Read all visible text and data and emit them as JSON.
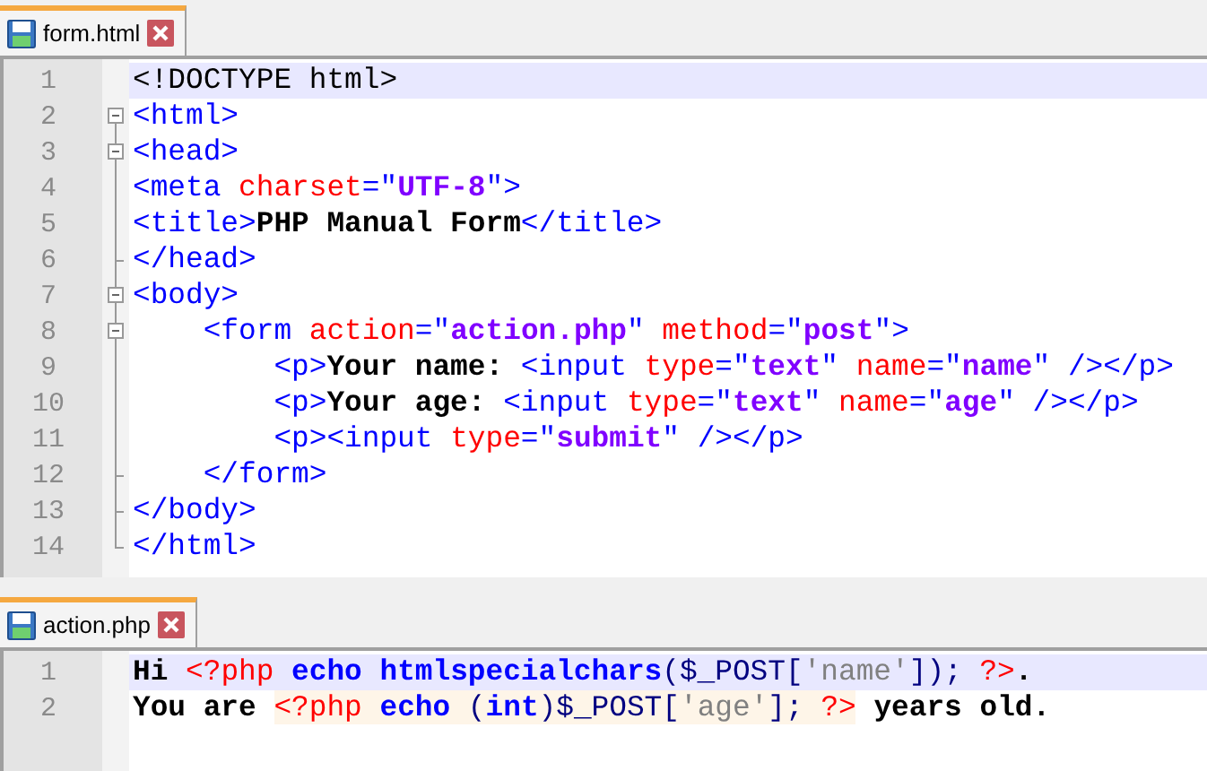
{
  "editors": [
    {
      "tab": {
        "label": "form.html",
        "selected": true
      },
      "lines": [
        {
          "number": "1",
          "current": true,
          "tokens": [
            {
              "kind": "doctype",
              "text": "<!DOCTYPE html>"
            }
          ]
        },
        {
          "number": "2",
          "current": false,
          "fold": {
            "kind": "box"
          },
          "tokens": [
            {
              "kind": "tag",
              "text": "<html>"
            }
          ]
        },
        {
          "number": "3",
          "current": false,
          "fold": {
            "kind": "box"
          },
          "tokens": [
            {
              "kind": "tag",
              "text": "<head>"
            }
          ]
        },
        {
          "number": "4",
          "current": false,
          "fold": {
            "kind": "line"
          },
          "tokens": [
            {
              "kind": "tag",
              "text": "<meta "
            },
            {
              "kind": "attr",
              "text": "charset"
            },
            {
              "kind": "tag",
              "text": "=\""
            },
            {
              "kind": "value",
              "text": "UTF-8"
            },
            {
              "kind": "tag",
              "text": "\">"
            }
          ]
        },
        {
          "number": "5",
          "current": false,
          "fold": {
            "kind": "line"
          },
          "tokens": [
            {
              "kind": "tag",
              "text": "<title>"
            },
            {
              "kind": "text",
              "text": "PHP Manual Form"
            },
            {
              "kind": "tag",
              "text": "</title>"
            }
          ]
        },
        {
          "number": "6",
          "current": false,
          "fold": {
            "kind": "end"
          },
          "tokens": [
            {
              "kind": "tag",
              "text": "</head>"
            }
          ]
        },
        {
          "number": "7",
          "current": false,
          "fold": {
            "kind": "box"
          },
          "tokens": [
            {
              "kind": "tag",
              "text": "<body>"
            }
          ]
        },
        {
          "number": "8",
          "current": false,
          "fold": {
            "kind": "box"
          },
          "tokens": [
            {
              "kind": "tag",
              "text": "    <form "
            },
            {
              "kind": "attr",
              "text": "action"
            },
            {
              "kind": "tag",
              "text": "=\""
            },
            {
              "kind": "value",
              "text": "action.php"
            },
            {
              "kind": "tag",
              "text": "\" "
            },
            {
              "kind": "attr",
              "text": "method"
            },
            {
              "kind": "tag",
              "text": "=\""
            },
            {
              "kind": "value",
              "text": "post"
            },
            {
              "kind": "tag",
              "text": "\">"
            }
          ]
        },
        {
          "number": "9",
          "current": false,
          "fold": {
            "kind": "line"
          },
          "tokens": [
            {
              "kind": "tag",
              "text": "        <p>"
            },
            {
              "kind": "text",
              "text": "Your name: "
            },
            {
              "kind": "tag",
              "text": "<input "
            },
            {
              "kind": "attr",
              "text": "type"
            },
            {
              "kind": "tag",
              "text": "=\""
            },
            {
              "kind": "value",
              "text": "text"
            },
            {
              "kind": "tag",
              "text": "\" "
            },
            {
              "kind": "attr",
              "text": "name"
            },
            {
              "kind": "tag",
              "text": "=\""
            },
            {
              "kind": "value",
              "text": "name"
            },
            {
              "kind": "tag",
              "text": "\" /></p>"
            }
          ]
        },
        {
          "number": "10",
          "current": false,
          "fold": {
            "kind": "line"
          },
          "tokens": [
            {
              "kind": "tag",
              "text": "        <p>"
            },
            {
              "kind": "text",
              "text": "Your age: "
            },
            {
              "kind": "tag",
              "text": "<input "
            },
            {
              "kind": "attr",
              "text": "type"
            },
            {
              "kind": "tag",
              "text": "=\""
            },
            {
              "kind": "value",
              "text": "text"
            },
            {
              "kind": "tag",
              "text": "\" "
            },
            {
              "kind": "attr",
              "text": "name"
            },
            {
              "kind": "tag",
              "text": "=\""
            },
            {
              "kind": "value",
              "text": "age"
            },
            {
              "kind": "tag",
              "text": "\" /></p>"
            }
          ]
        },
        {
          "number": "11",
          "current": false,
          "fold": {
            "kind": "line"
          },
          "tokens": [
            {
              "kind": "tag",
              "text": "        <p><input "
            },
            {
              "kind": "attr",
              "text": "type"
            },
            {
              "kind": "tag",
              "text": "=\""
            },
            {
              "kind": "value",
              "text": "submit"
            },
            {
              "kind": "tag",
              "text": "\" /></p>"
            }
          ]
        },
        {
          "number": "12",
          "current": false,
          "fold": {
            "kind": "end"
          },
          "tokens": [
            {
              "kind": "tag",
              "text": "    </form>"
            }
          ]
        },
        {
          "number": "13",
          "current": false,
          "fold": {
            "kind": "end"
          },
          "tokens": [
            {
              "kind": "tag",
              "text": "</body>"
            }
          ]
        },
        {
          "number": "14",
          "current": false,
          "fold": {
            "kind": "last"
          },
          "tokens": [
            {
              "kind": "tag",
              "text": "</html>"
            }
          ]
        }
      ]
    },
    {
      "tab": {
        "label": "action.php",
        "selected": true
      },
      "lines": [
        {
          "number": "1",
          "current": true,
          "tokens": [
            {
              "kind": "text",
              "text": "Hi "
            },
            {
              "kind": "php-delim",
              "text": "<?php "
            },
            {
              "kind": "keyword",
              "text": "echo "
            },
            {
              "kind": "keyword",
              "text": "htmlspecialchars"
            },
            {
              "kind": "op",
              "text": "($_POST["
            },
            {
              "kind": "string",
              "text": "'name'"
            },
            {
              "kind": "op",
              "text": "]); "
            },
            {
              "kind": "php-delim",
              "text": "?>"
            },
            {
              "kind": "text",
              "text": "."
            }
          ]
        },
        {
          "number": "2",
          "current": false,
          "tokens": [
            {
              "kind": "text",
              "text": "You are "
            },
            {
              "kind": "php-delim",
              "text": "<?php "
            },
            {
              "kind": "keyword",
              "text": "echo "
            },
            {
              "kind": "op",
              "text": "("
            },
            {
              "kind": "keyword",
              "text": "int"
            },
            {
              "kind": "op",
              "text": ")$_POST["
            },
            {
              "kind": "string",
              "text": "'age'"
            },
            {
              "kind": "op",
              "text": "]; "
            },
            {
              "kind": "php-delim",
              "text": "?>"
            },
            {
              "kind": "text",
              "text": " years old."
            }
          ]
        }
      ]
    }
  ]
}
